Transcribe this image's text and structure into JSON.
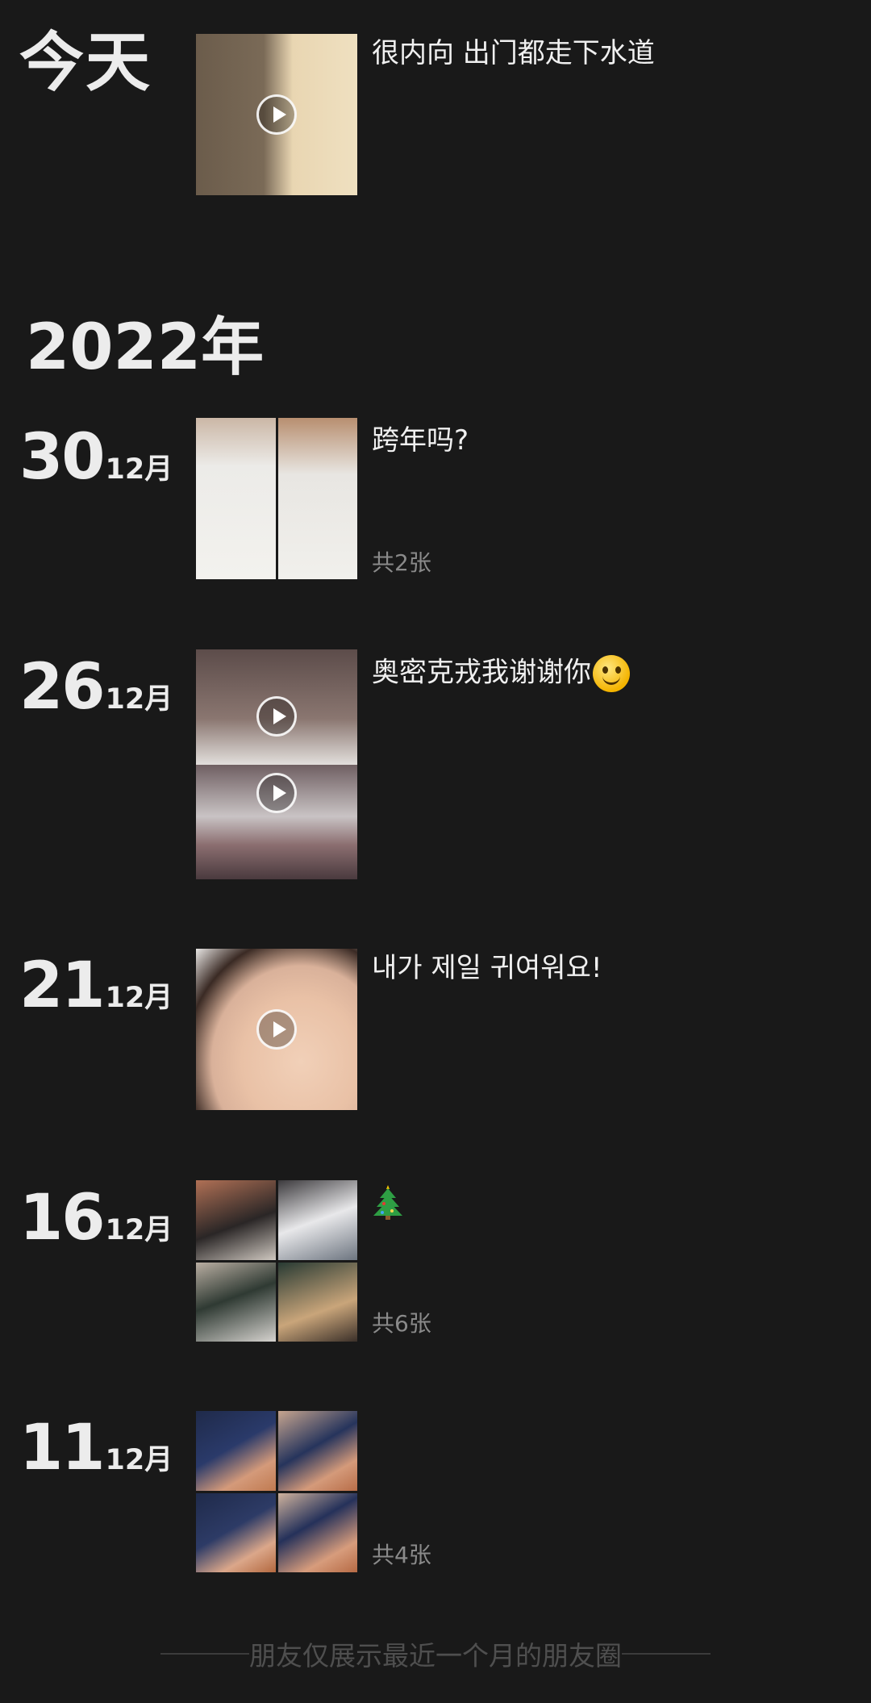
{
  "today": {
    "label": "今天",
    "caption": "很内向  出门都走下水道"
  },
  "year": "2022年",
  "posts": [
    {
      "day": "30",
      "month": "12月",
      "caption": "跨年吗?",
      "count": "共2张"
    },
    {
      "day": "26",
      "month": "12月",
      "caption": "奥密克戎我谢谢你",
      "emoji": "smile-emoji"
    },
    {
      "day": "21",
      "month": "12月",
      "caption": "내가 제일 귀여워요!"
    },
    {
      "day": "16",
      "month": "12月",
      "emoji": "christmas-tree-emoji",
      "count": "共6张"
    },
    {
      "day": "11",
      "month": "12月",
      "count": "共4张"
    }
  ],
  "footer": "朋友仅展示最近一个月的朋友圈",
  "colors": {
    "background": "#191919",
    "text": "#ececec",
    "muted": "#8a8a8a",
    "footer": "#4f4f4f"
  }
}
